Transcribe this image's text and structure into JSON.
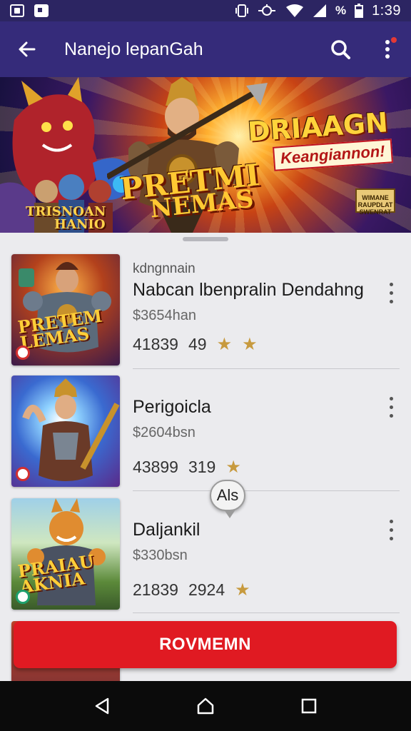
{
  "status_bar": {
    "battery_percent_glyph": "%",
    "time": "1:39"
  },
  "app_bar": {
    "title": "Nanejo lepanGah",
    "icons": [
      "back-arrow-icon",
      "search-icon",
      "more-vertical-icon"
    ]
  },
  "banner": {
    "headline": "DRIAAGN",
    "subheadline": "Keangiannon!",
    "logo_line1": "PRETMI",
    "logo_line2": "NEMAS",
    "corner_text_line1": "TRISNOAN",
    "corner_text_line2": "HANIO",
    "badge_text": "WIMANE RAUPDLAT SWENRAT"
  },
  "list": {
    "items": [
      {
        "subtitle": "kdngnnain",
        "title": "Nabcan lbenpralin Dendahng",
        "price": "$3654han",
        "meta_left": "41839",
        "meta_mid": "49",
        "thumb_title": "PRETEM LEMAS",
        "thumb_badge": "red"
      },
      {
        "subtitle": "",
        "title": "Perigoicla",
        "price": "$2604bsn",
        "meta_left": "43899",
        "meta_mid": "319",
        "thumb_title": "",
        "thumb_badge": "red"
      },
      {
        "subtitle": "",
        "title": "Daljankil",
        "price": "$330bsn",
        "meta_left": "21839",
        "meta_mid": "2924",
        "thumb_title": "PRAIAU AKNIA",
        "thumb_badge": "green"
      }
    ]
  },
  "tooltip": {
    "label": "Als"
  },
  "cta": {
    "label": "ROVMEMN"
  },
  "colors": {
    "app_bar": "#352b7a",
    "status_bar": "#2c2562",
    "cta": "#e01a22",
    "star": "#c79a3e"
  }
}
